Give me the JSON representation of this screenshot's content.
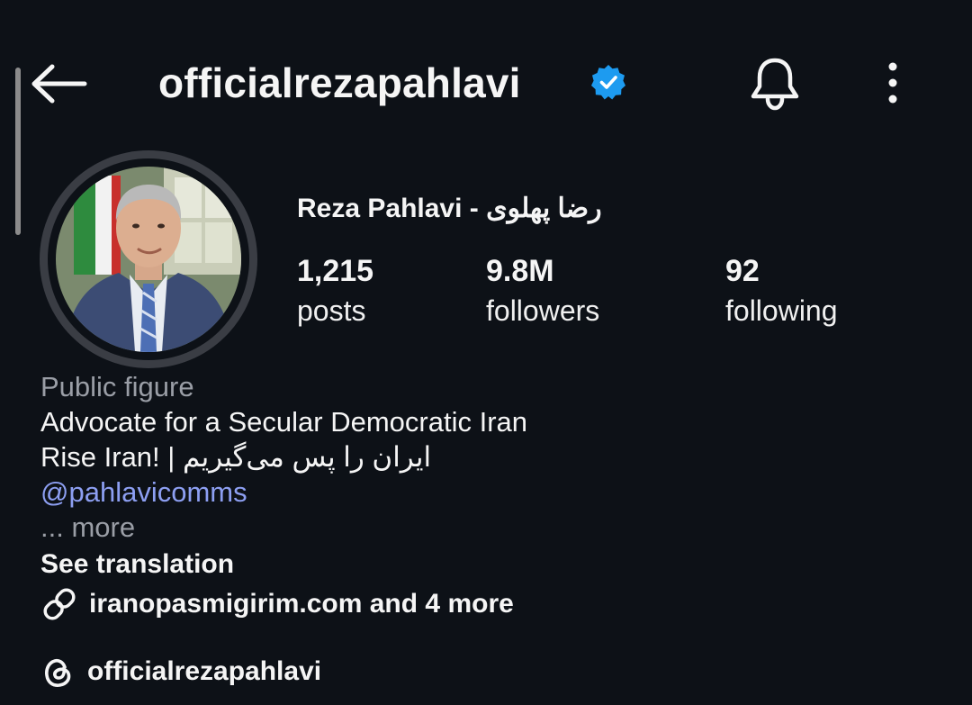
{
  "header": {
    "username": "officialrezapahlavi",
    "verified": true,
    "icons": [
      "back-arrow-icon",
      "verified-badge-icon",
      "bell-icon",
      "more-vertical-icon"
    ]
  },
  "profile": {
    "display_name": "Reza Pahlavi - رضا پهلوی",
    "stats": [
      {
        "value": "1,215",
        "label": "posts"
      },
      {
        "value": "9.8M",
        "label": "followers"
      },
      {
        "value": "92",
        "label": "following"
      }
    ],
    "category": "Public figure",
    "bio_lines": [
      "Advocate for a Secular Democratic Iran",
      "Rise Iran! | ایران را پس می‌گیریم"
    ],
    "mention": "@pahlavicomms",
    "more_label": "... more",
    "see_translation": "See translation",
    "link_text": "iranopasmigirim.com and 4 more",
    "threads_handle": "officialrezapahlavi"
  },
  "colors": {
    "background": "#0d1117",
    "text": "#f5f5f5",
    "muted": "#9a9ea6",
    "mention": "#8d9ff2",
    "verified": "#1d9bf0"
  }
}
